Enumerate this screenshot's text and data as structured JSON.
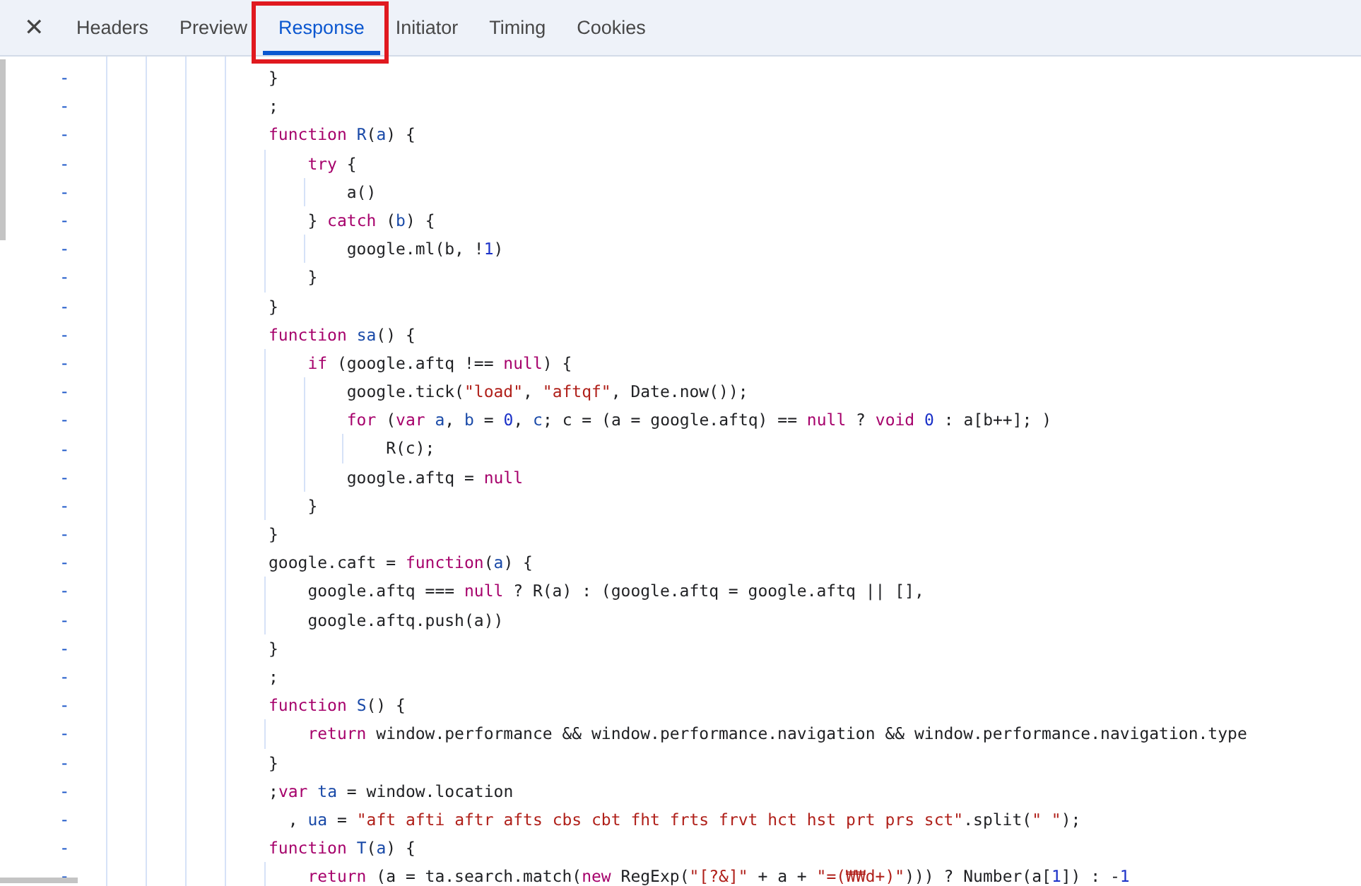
{
  "tabs": [
    {
      "label": "Headers",
      "selected": false
    },
    {
      "label": "Preview",
      "selected": false
    },
    {
      "label": "Response",
      "selected": true,
      "highlighted": true
    },
    {
      "label": "Initiator",
      "selected": false
    },
    {
      "label": "Timing",
      "selected": false
    },
    {
      "label": "Cookies",
      "selected": false
    }
  ],
  "close": "✕",
  "lines": [
    {
      "marker": "-",
      "tokens": [
        {
          "kind": "plain",
          "text": "}"
        }
      ]
    },
    {
      "marker": "-",
      "tokens": [
        {
          "kind": "plain",
          "text": ";"
        }
      ]
    },
    {
      "marker": "-",
      "tokens": [
        {
          "kind": "keyword",
          "text": "function"
        },
        {
          "kind": "name",
          "text": " R"
        },
        {
          "kind": "plain",
          "text": "("
        },
        {
          "kind": "name",
          "text": "a"
        },
        {
          "kind": "plain",
          "text": ") {"
        }
      ]
    },
    {
      "marker": "-",
      "tokens": [
        {
          "kind": "keyword",
          "text": "    try"
        },
        {
          "kind": "plain",
          "text": " {"
        }
      ]
    },
    {
      "marker": "-",
      "tokens": [
        {
          "kind": "plain",
          "text": "        a()"
        }
      ]
    },
    {
      "marker": "-",
      "tokens": [
        {
          "kind": "plain",
          "text": "    } "
        },
        {
          "kind": "keyword",
          "text": "catch"
        },
        {
          "kind": "plain",
          "text": " ("
        },
        {
          "kind": "name",
          "text": "b"
        },
        {
          "kind": "plain",
          "text": ") {"
        }
      ]
    },
    {
      "marker": "-",
      "tokens": [
        {
          "kind": "plain",
          "text": "        google.ml(b, !"
        },
        {
          "kind": "number",
          "text": "1"
        },
        {
          "kind": "plain",
          "text": ")"
        }
      ]
    },
    {
      "marker": "-",
      "tokens": [
        {
          "kind": "plain",
          "text": "    }"
        }
      ]
    },
    {
      "marker": "-",
      "tokens": [
        {
          "kind": "plain",
          "text": "}"
        }
      ]
    },
    {
      "marker": "-",
      "tokens": [
        {
          "kind": "keyword",
          "text": "function"
        },
        {
          "kind": "name",
          "text": " sa"
        },
        {
          "kind": "plain",
          "text": "() {"
        }
      ]
    },
    {
      "marker": "-",
      "tokens": [
        {
          "kind": "keyword",
          "text": "    if"
        },
        {
          "kind": "plain",
          "text": " (google.aftq !== "
        },
        {
          "kind": "keyword",
          "text": "null"
        },
        {
          "kind": "plain",
          "text": ") {"
        }
      ]
    },
    {
      "marker": "-",
      "tokens": [
        {
          "kind": "plain",
          "text": "        google.tick("
        },
        {
          "kind": "string",
          "text": "\"load\""
        },
        {
          "kind": "plain",
          "text": ", "
        },
        {
          "kind": "string",
          "text": "\"aftqf\""
        },
        {
          "kind": "plain",
          "text": ", Date.now());"
        }
      ]
    },
    {
      "marker": "-",
      "tokens": [
        {
          "kind": "keyword",
          "text": "        for"
        },
        {
          "kind": "plain",
          "text": " ("
        },
        {
          "kind": "keyword",
          "text": "var"
        },
        {
          "kind": "name",
          "text": " a"
        },
        {
          "kind": "plain",
          "text": ", "
        },
        {
          "kind": "name",
          "text": "b"
        },
        {
          "kind": "plain",
          "text": " = "
        },
        {
          "kind": "number",
          "text": "0"
        },
        {
          "kind": "plain",
          "text": ", "
        },
        {
          "kind": "name",
          "text": "c"
        },
        {
          "kind": "plain",
          "text": "; c = (a = google.aftq) == "
        },
        {
          "kind": "keyword",
          "text": "null"
        },
        {
          "kind": "plain",
          "text": " ? "
        },
        {
          "kind": "keyword",
          "text": "void"
        },
        {
          "kind": "number",
          "text": " 0"
        },
        {
          "kind": "plain",
          "text": " : a[b++]; )"
        }
      ]
    },
    {
      "marker": "-",
      "tokens": [
        {
          "kind": "plain",
          "text": "            R(c);"
        }
      ]
    },
    {
      "marker": "-",
      "tokens": [
        {
          "kind": "plain",
          "text": "        google.aftq = "
        },
        {
          "kind": "keyword",
          "text": "null"
        }
      ]
    },
    {
      "marker": "-",
      "tokens": [
        {
          "kind": "plain",
          "text": "    }"
        }
      ]
    },
    {
      "marker": "-",
      "tokens": [
        {
          "kind": "plain",
          "text": "}"
        }
      ]
    },
    {
      "marker": "-",
      "tokens": [
        {
          "kind": "plain",
          "text": "google.caft = "
        },
        {
          "kind": "keyword",
          "text": "function"
        },
        {
          "kind": "plain",
          "text": "("
        },
        {
          "kind": "name",
          "text": "a"
        },
        {
          "kind": "plain",
          "text": ") {"
        }
      ]
    },
    {
      "marker": "-",
      "tokens": [
        {
          "kind": "plain",
          "text": "    google.aftq === "
        },
        {
          "kind": "keyword",
          "text": "null"
        },
        {
          "kind": "plain",
          "text": " ? R(a) : (google.aftq = google.aftq || [],"
        }
      ]
    },
    {
      "marker": "-",
      "tokens": [
        {
          "kind": "plain",
          "text": "    google.aftq.push(a))"
        }
      ]
    },
    {
      "marker": "-",
      "tokens": [
        {
          "kind": "plain",
          "text": "}"
        }
      ]
    },
    {
      "marker": "-",
      "tokens": [
        {
          "kind": "plain",
          "text": ";"
        }
      ]
    },
    {
      "marker": "-",
      "tokens": [
        {
          "kind": "keyword",
          "text": "function"
        },
        {
          "kind": "name",
          "text": " S"
        },
        {
          "kind": "plain",
          "text": "() {"
        }
      ]
    },
    {
      "marker": "-",
      "tokens": [
        {
          "kind": "keyword",
          "text": "    return"
        },
        {
          "kind": "plain",
          "text": " window.performance && window.performance.navigation && window.performance.navigation.type"
        }
      ]
    },
    {
      "marker": "-",
      "tokens": [
        {
          "kind": "plain",
          "text": "}"
        }
      ]
    },
    {
      "marker": "-",
      "tokens": [
        {
          "kind": "plain",
          "text": ";"
        },
        {
          "kind": "keyword",
          "text": "var"
        },
        {
          "kind": "name",
          "text": " ta"
        },
        {
          "kind": "plain",
          "text": " = window.location"
        }
      ]
    },
    {
      "marker": "-",
      "tokens": [
        {
          "kind": "plain",
          "text": "  , "
        },
        {
          "kind": "name",
          "text": "ua"
        },
        {
          "kind": "plain",
          "text": " = "
        },
        {
          "kind": "string",
          "text": "\"aft afti aftr afts cbs cbt fht frts frvt hct hst prt prs sct\""
        },
        {
          "kind": "plain",
          "text": ".split("
        },
        {
          "kind": "string",
          "text": "\" \""
        },
        {
          "kind": "plain",
          "text": ");"
        }
      ]
    },
    {
      "marker": "-",
      "tokens": [
        {
          "kind": "keyword",
          "text": "function"
        },
        {
          "kind": "name",
          "text": " T"
        },
        {
          "kind": "plain",
          "text": "("
        },
        {
          "kind": "name",
          "text": "a"
        },
        {
          "kind": "plain",
          "text": ") {"
        }
      ]
    },
    {
      "marker": "-",
      "tokens": [
        {
          "kind": "keyword",
          "text": "    return"
        },
        {
          "kind": "plain",
          "text": " (a = ta.search.match("
        },
        {
          "kind": "keyword",
          "text": "new"
        },
        {
          "kind": "plain",
          "text": " RegExp("
        },
        {
          "kind": "string",
          "text": "\"[?&]\""
        },
        {
          "kind": "plain",
          "text": " + a + "
        },
        {
          "kind": "string",
          "text": "\"=(₩₩d+)\""
        },
        {
          "kind": "plain",
          "text": "))) ? Number(a["
        },
        {
          "kind": "number",
          "text": "1"
        },
        {
          "kind": "plain",
          "text": "]) : -"
        },
        {
          "kind": "number",
          "text": "1"
        }
      ]
    }
  ]
}
